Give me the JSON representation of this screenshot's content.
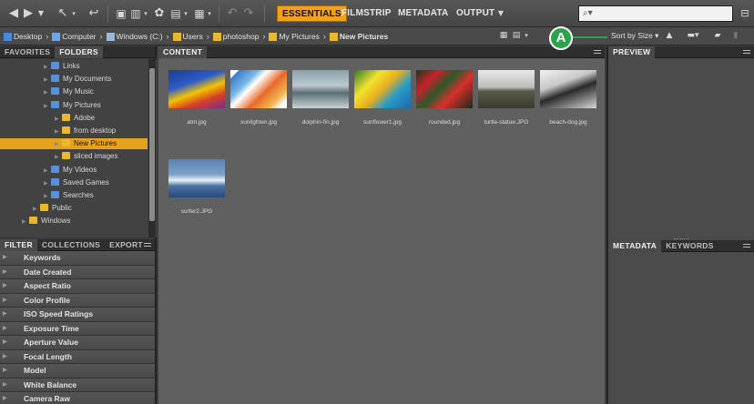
{
  "toolbar": {
    "workspaces": [
      "ESSENTIALS",
      "FILMSTRIP",
      "METADATA",
      "OUTPUT"
    ],
    "active_workspace": "ESSENTIALS",
    "search_glyph": "⌕▾"
  },
  "path": {
    "crumbs": [
      {
        "label": "Desktop",
        "icon": "desktop-icon"
      },
      {
        "label": "Computer",
        "icon": "computer-icon"
      },
      {
        "label": "Windows (C:)",
        "icon": "drive-icon"
      },
      {
        "label": "Users",
        "icon": "folder-icon"
      },
      {
        "label": "photoshop",
        "icon": "user-folder-icon"
      },
      {
        "label": "My Pictures",
        "icon": "folder-icon"
      },
      {
        "label": "New Pictures",
        "icon": "folder-icon"
      }
    ],
    "sort_label": "Sort by Size ▾"
  },
  "callout": {
    "label": "A",
    "color": "#2aa34a"
  },
  "left_panel": {
    "tabs": [
      "FAVORITES",
      "FOLDERS"
    ],
    "active_tab": "FOLDERS",
    "tree": [
      {
        "label": "Links",
        "depth": 2,
        "selected": false,
        "color": "#5b8fd6"
      },
      {
        "label": "My Documents",
        "depth": 2,
        "selected": false,
        "color": "#5b8fd6"
      },
      {
        "label": "My Music",
        "depth": 2,
        "selected": false,
        "color": "#5b8fd6"
      },
      {
        "label": "My Pictures",
        "depth": 2,
        "selected": false,
        "color": "#5b8fd6"
      },
      {
        "label": "Adobe",
        "depth": 3,
        "selected": false,
        "color": "#e8b830"
      },
      {
        "label": "from desktop",
        "depth": 3,
        "selected": false,
        "color": "#e8b830"
      },
      {
        "label": "New Pictures",
        "depth": 3,
        "selected": true,
        "color": "#e8b830"
      },
      {
        "label": "sliced images",
        "depth": 3,
        "selected": false,
        "color": "#e8b830"
      },
      {
        "label": "My Videos",
        "depth": 2,
        "selected": false,
        "color": "#5b8fd6"
      },
      {
        "label": "Saved Games",
        "depth": 2,
        "selected": false,
        "color": "#5b8fd6"
      },
      {
        "label": "Searches",
        "depth": 2,
        "selected": false,
        "color": "#5b8fd6"
      },
      {
        "label": "Public",
        "depth": 1,
        "selected": false,
        "color": "#e8b830"
      },
      {
        "label": "Windows",
        "depth": 0,
        "selected": false,
        "color": "#e8b830"
      }
    ]
  },
  "filter_panel": {
    "tabs": [
      "FILTER",
      "COLLECTIONS",
      "EXPORT"
    ],
    "active_tab": "FILTER",
    "items": [
      "Keywords",
      "Date Created",
      "Aspect Ratio",
      "Color Profile",
      "ISO Speed Ratings",
      "Exposure Time",
      "Aperture Value",
      "Focal Length",
      "Model",
      "White Balance",
      "Camera Raw"
    ]
  },
  "content_panel": {
    "tab": "CONTENT",
    "thumbnails": [
      {
        "file": "atm.jpg"
      },
      {
        "file": "sunlighten.jpg"
      },
      {
        "file": "dolphin-fin.jpg"
      },
      {
        "file": "sunflower1.jpg"
      },
      {
        "file": "rounded.jpg"
      },
      {
        "file": "turtle-statue.JPG"
      },
      {
        "file": "beach-dog.jpg"
      },
      {
        "file": "surfer2.JPG"
      }
    ]
  },
  "preview_panel": {
    "tab": "PREVIEW"
  },
  "metadata_panel": {
    "tabs": [
      "METADATA",
      "KEYWORDS"
    ],
    "active_tab": "METADATA"
  }
}
